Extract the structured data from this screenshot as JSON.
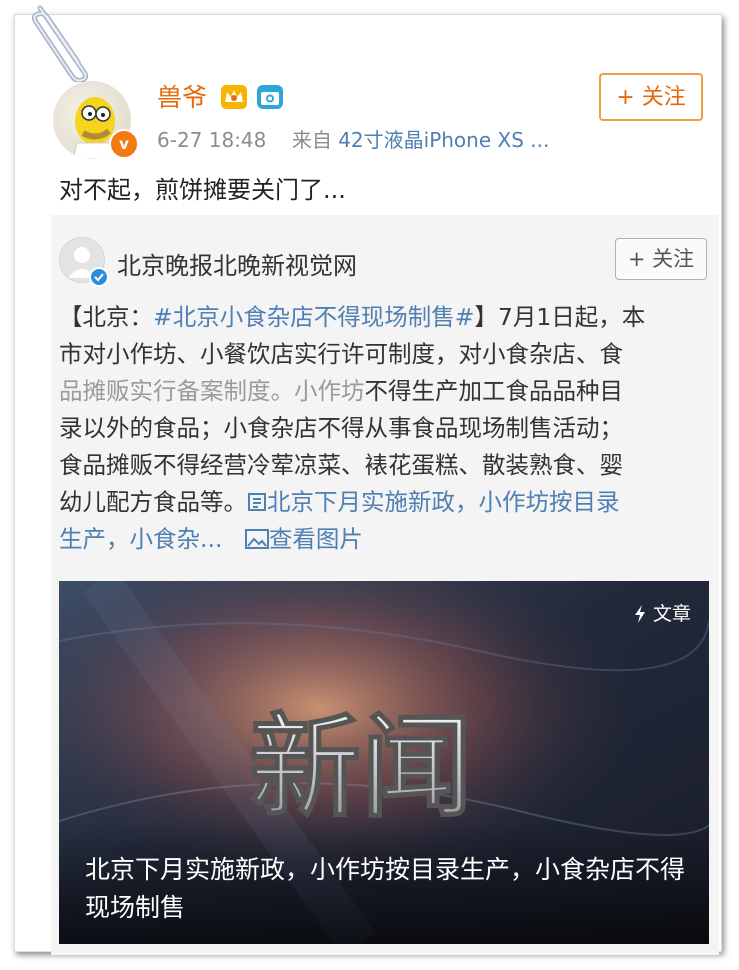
{
  "post": {
    "username": "兽爷",
    "time": "6-27 18:48",
    "source_prefix": "来自",
    "source": "42寸液晶iPhone XS ...",
    "follow_label": "+ 关注",
    "text": "对不起，煎饼摊要关门了..."
  },
  "repost": {
    "author": "北京晚报北晚新视觉网",
    "follow_label": "+ 关注",
    "body": {
      "line1_a": "【北京：",
      "line1_topic": "#北京小食杂店不得现场制售#",
      "line1_b": "】7月1日起，本",
      "line2": "市对小作坊、小餐饮店实行许可制度，对小食杂店、食",
      "line3_faded": "品摊贩实行备案制度。小作坊",
      "line3_b": "不得生产加工食品品种目",
      "line4": "录以外的食品；小食杂店不得从事食品现场制售活动；",
      "line5": "食品摊贩不得经营冷荤凉菜、裱花蛋糕、散装熟食、婴",
      "line6_a": "幼儿配方食品等。",
      "line6_link": "北京下月实施新政，小作坊按目录",
      "line7_link": "生产，小食杂...",
      "view_images": "查看图片"
    },
    "card": {
      "label": "文章",
      "image_text": "新闻",
      "caption": "北京下月实施新政，小作坊按目录生产，小食杂店不得现场制售"
    }
  },
  "colors": {
    "orange": "#e8690a",
    "link_blue": "#4f7fb3",
    "verify_orange": "#f07b0e",
    "verify_blue": "#2b8ed8"
  },
  "icons": [
    "paperclip-icon",
    "crown-badge-icon",
    "camera-badge-icon",
    "verified-icon",
    "article-link-icon",
    "image-icon",
    "lightning-icon"
  ]
}
